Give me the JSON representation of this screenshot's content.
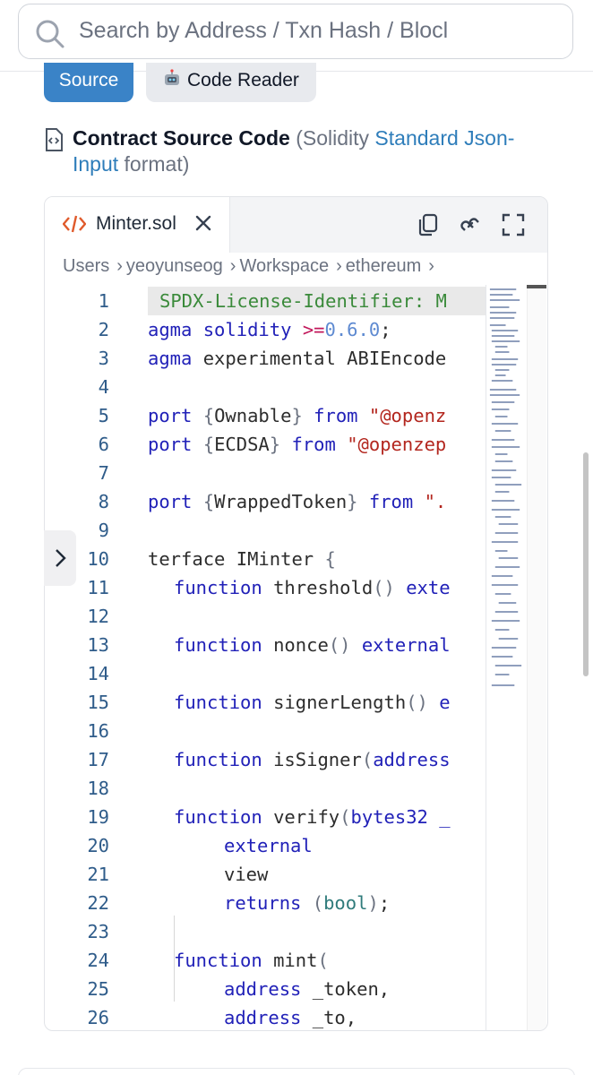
{
  "search": {
    "placeholder": "Search by Address / Txn Hash / Blocl"
  },
  "tabs": {
    "source": "Source",
    "code_reader": "Code Reader"
  },
  "heading": {
    "title": "Contract Source Code",
    "paren_open": " (Solidity ",
    "link": "Standard Json-Input",
    "paren_close": " format)"
  },
  "editor": {
    "file_tab": "Minter.sol",
    "breadcrumb": [
      "Users",
      "yeoyunseog",
      "Workspace",
      "ethereum"
    ],
    "icons": [
      "code-file-icon",
      "close-icon",
      "copy-icon",
      "link-icon",
      "fullscreen-icon",
      "chevron-right-icon"
    ],
    "line_numbers": [
      "1",
      "2",
      "3",
      "4",
      "5",
      "6",
      "7",
      "8",
      "9",
      "10",
      "11",
      "12",
      "13",
      "14",
      "15",
      "16",
      "17",
      "18",
      "19",
      "20",
      "21",
      "22",
      "23",
      "24",
      "25",
      "26"
    ],
    "code": {
      "l1": "SPDX-License-Identifier: M",
      "l2_a": "agma ",
      "l2_b": "solidity ",
      "l2_c": ">=",
      "l2_d": "0.6.0",
      "l2_e": ";",
      "l3_a": "agma ",
      "l3_b": "experimental ABIEncode",
      "l5_a": "port ",
      "l5_b": "{",
      "l5_c": "Ownable",
      "l5_d": "} ",
      "l5_e": "from ",
      "l5_f": "\"@openz",
      "l6_a": "port ",
      "l6_b": "{",
      "l6_c": "ECDSA",
      "l6_d": "} ",
      "l6_e": "from ",
      "l6_f": "\"@openzep",
      "l8_a": "port ",
      "l8_b": "{",
      "l8_c": "WrappedToken",
      "l8_d": "} ",
      "l8_e": "from ",
      "l8_f": "\".",
      "l10_a": "terface IMinter ",
      "l10_b": "{",
      "l11_a": "function ",
      "l11_b": "threshold",
      "l11_c": "() ",
      "l11_d": "exte",
      "l13_a": "function ",
      "l13_b": "nonce",
      "l13_c": "() ",
      "l13_d": "external",
      "l15_a": "function ",
      "l15_b": "signerLength",
      "l15_c": "() ",
      "l15_d": "e",
      "l17_a": "function ",
      "l17_b": "isSigner",
      "l17_c": "(",
      "l17_d": "address",
      "l19_a": "function ",
      "l19_b": "verify",
      "l19_c": "(",
      "l19_d": "bytes32 _",
      "l20": "external",
      "l21": "view",
      "l22_a": "returns ",
      "l22_b": "(",
      "l22_c": "bool",
      "l22_d": ")",
      "l22_e": ";",
      "l24_a": "function ",
      "l24_b": "mint",
      "l24_c": "(",
      "l25_a": "address ",
      "l25_b": "_token,",
      "l26_a": "address ",
      "l26_b": "_to,"
    }
  },
  "colors": {
    "accent": "#3a83c7",
    "link": "#2e7dba",
    "keyword": "#2121b8"
  }
}
